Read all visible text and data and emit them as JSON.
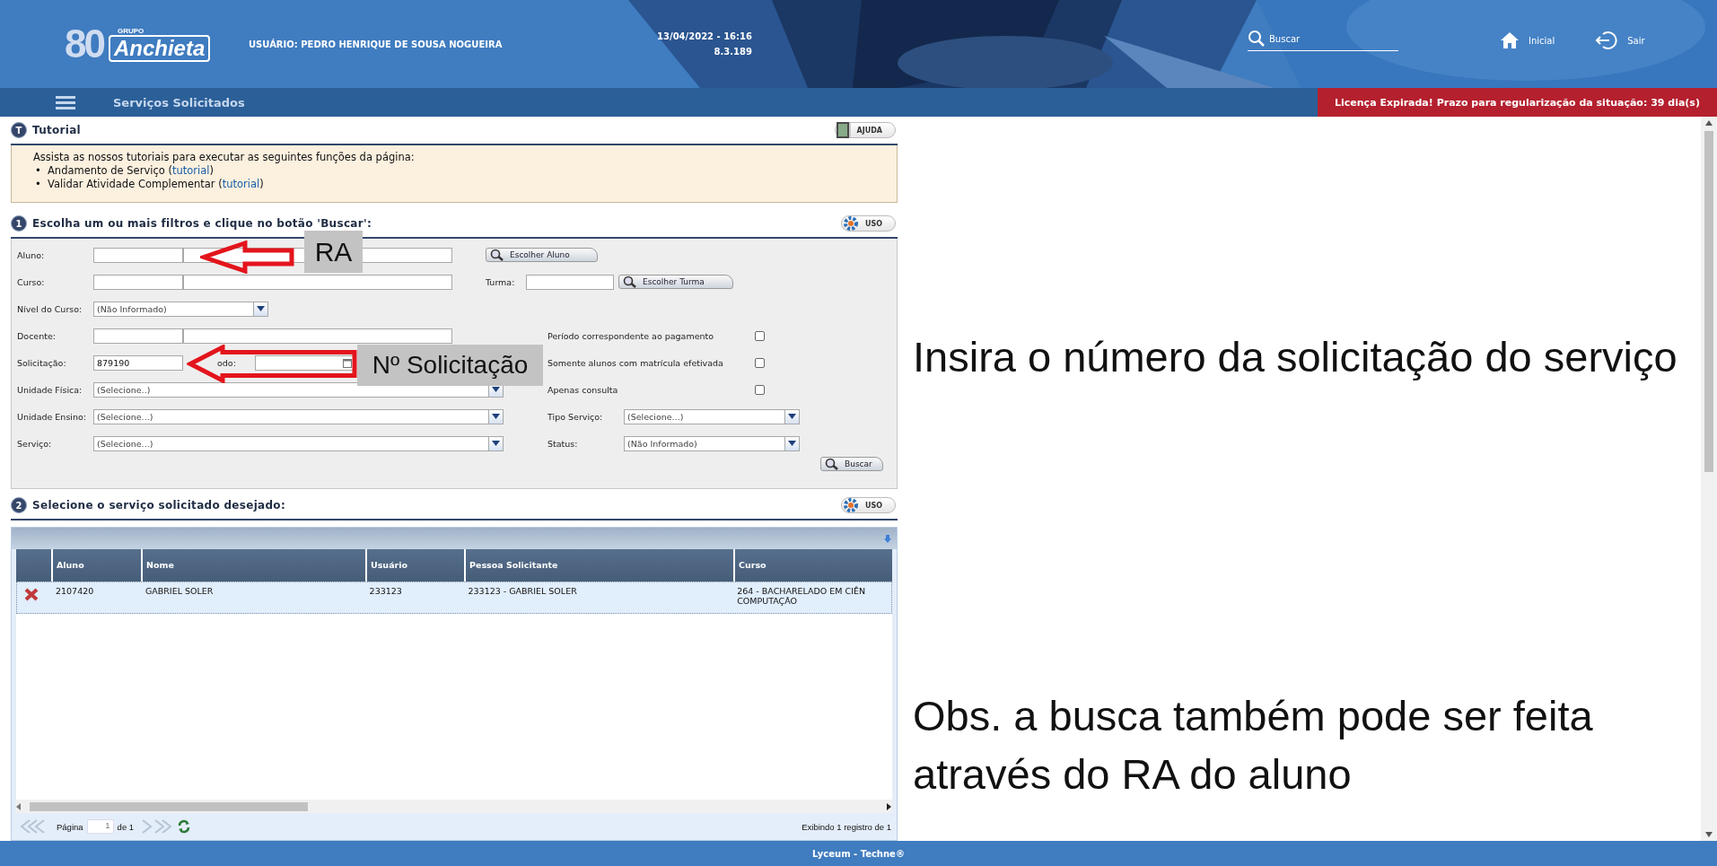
{
  "header": {
    "logo_number": "80",
    "brand_small": "GRUPO",
    "brand": "Anchieta",
    "user": "USUÁRIO: PEDRO HENRIQUE DE SOUSA NOGUEIRA",
    "datetime": "13/04/2022 - 16:16",
    "version": "8.3.189",
    "search_placeholder": "Buscar",
    "nav": [
      {
        "label": "Inicial",
        "kind": "home"
      },
      {
        "label": "Sair",
        "kind": "exit"
      }
    ]
  },
  "page_title": "Serviços Solicitados",
  "license_notice": "Licença Expirada! Prazo para regularização da situação: 39 dia(s)",
  "tutorial": {
    "badge": "T",
    "title": "Tutorial",
    "help_button": "AJUDA",
    "intro": "Assista as nossos tutoriais para executar as seguintes funções da página:",
    "items": [
      {
        "bullet": "•",
        "text": "Andamento de Serviço (",
        "link": "tutorial",
        "after": ")"
      },
      {
        "bullet": "•",
        "text": "Validar Atividade Complementar (",
        "link": "tutorial",
        "after": ")"
      }
    ]
  },
  "filters": {
    "badge": "1",
    "title": "Escolha um ou mais filtros e clique no botão 'Buscar':",
    "usage_button": "USO",
    "rows": [
      {
        "label": "Aluno:",
        "kind": "pair",
        "right": {
          "kind": "button",
          "label": "Escolher Aluno"
        }
      },
      {
        "label": "Curso:",
        "kind": "pair",
        "right": {
          "kind": "turma",
          "label": "Turma:",
          "button": "Escolher Turma"
        }
      },
      {
        "label": "Nível do Curso:",
        "kind": "short_select",
        "value": "(Não Informado)"
      },
      {
        "label": "Docente:",
        "kind": "wide_pair",
        "right": {
          "kind": "checkbox",
          "label": "Período correspondente ao pagamento",
          "checked": false
        }
      },
      {
        "label": "Solicitação:",
        "kind": "request",
        "value": "879190",
        "period_label": "odo:",
        "right": {
          "kind": "checkbox",
          "label": "Somente alunos com matrícula efetivada",
          "checked": false
        }
      },
      {
        "label": "Unidade Física:",
        "kind": "select",
        "value": "(Selecione..)",
        "right": {
          "kind": "checkbox",
          "label": "Apenas consulta",
          "checked": false
        }
      },
      {
        "label": "Unidade Ensino:",
        "kind": "select",
        "value": "(Selecione...)",
        "right": {
          "kind": "select",
          "label": "Tipo Serviço:",
          "value": "(Selecione...)"
        }
      },
      {
        "label": "Serviço:",
        "kind": "select",
        "value": "(Selecione...)",
        "right": {
          "kind": "select",
          "label": "Status:",
          "value": "(Não Informado)"
        }
      }
    ],
    "search_button": "Buscar",
    "annotations": [
      {
        "label": "RA"
      },
      {
        "label": "Nº Solicitação"
      }
    ]
  },
  "results": {
    "badge": "2",
    "title": "Selecione o serviço solicitado desejado:",
    "usage_button": "USO",
    "table": {
      "columns": [
        "Aluno",
        "Nome",
        "Usuário",
        "Pessoa Solicitante",
        "Curso"
      ],
      "rows": [
        {
          "selected": true,
          "cells": [
            "2107420",
            "GABRIEL SOLER",
            "233123",
            "233123 - GABRIEL SOLER",
            "264 - BACHARELADO EM CIÊN\nCOMPUTAÇÃO"
          ]
        }
      ]
    },
    "pager": {
      "page_label": "Página",
      "page": "1",
      "of": "de 1",
      "summary": "Exibindo 1 registro de 1"
    }
  },
  "notes": [
    "Insira o número da solicitação do serviço",
    "Obs. a busca também pode ser feita através do RA do aluno"
  ],
  "footer": "Lyceum - Techne®"
}
